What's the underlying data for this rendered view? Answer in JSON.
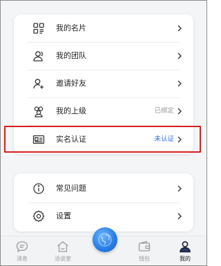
{
  "menu_card": {
    "items": [
      {
        "icon": "business-card-icon",
        "label": "我的名片",
        "right": ""
      },
      {
        "icon": "team-icon",
        "label": "我的团队",
        "right": ""
      },
      {
        "icon": "invite-user-icon",
        "label": "邀请好友",
        "right": ""
      },
      {
        "icon": "superior-icon",
        "label": "我的上级",
        "right": "已绑定"
      },
      {
        "icon": "id-card-icon",
        "label": "实名认证",
        "right": "未认证"
      }
    ]
  },
  "support_card": {
    "items": [
      {
        "icon": "info-icon",
        "label": "常见问题"
      },
      {
        "icon": "settings-icon",
        "label": "设置"
      }
    ]
  },
  "tabbar": {
    "items": [
      {
        "icon": "message-icon",
        "label": "消息"
      },
      {
        "icon": "negotiation-room-icon",
        "label": "洽谈室"
      },
      {
        "icon": "globe-icon",
        "label": ""
      },
      {
        "icon": "wallet-icon",
        "label": "钱包"
      },
      {
        "icon": "profile-icon",
        "label": "我的"
      }
    ],
    "active": "我的"
  },
  "colors": {
    "accent_blue": "#2e6be6",
    "highlight_red": "#d81e1e",
    "muted_text": "#9a9a9a"
  }
}
